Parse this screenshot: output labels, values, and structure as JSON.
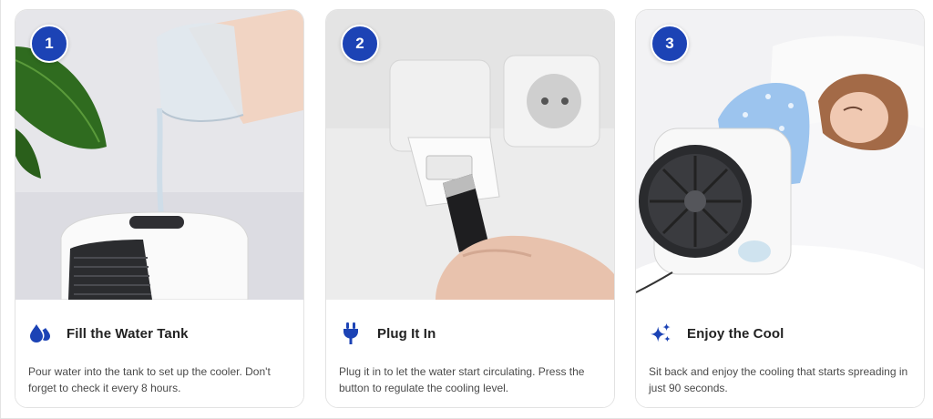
{
  "steps": [
    {
      "number": "1",
      "icon": "water-drops-icon",
      "title": "Fill the Water Tank",
      "description": "Pour water into the tank to set up the cooler. Don't forget to check it every 8 hours."
    },
    {
      "number": "2",
      "icon": "plug-icon",
      "title": "Plug It In",
      "description": "Plug it in to let the water start circulating. Press the button to regulate the cooling level."
    },
    {
      "number": "3",
      "icon": "sparkles-icon",
      "title": "Enjoy the Cool",
      "description": "Sit back and enjoy the cooling that starts spreading in just 90 seconds."
    }
  ],
  "colors": {
    "accent": "#1c43b5",
    "title_text": "#222222",
    "body_text": "#4a4a4a"
  }
}
